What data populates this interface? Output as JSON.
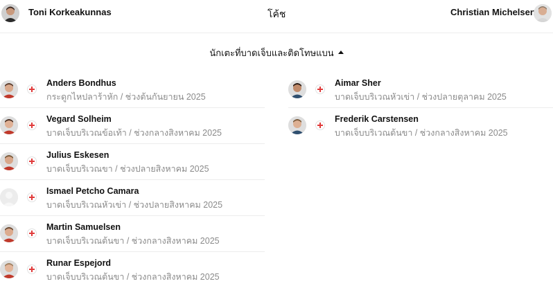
{
  "coaches": {
    "title": "โค้ช",
    "home_name": "Toni Korkeakunnas",
    "away_name": "Christian Michelsen"
  },
  "section": {
    "label": "นักเตะที่บาดเจ็บและติดโทษแบน",
    "icon": "caret-up-icon"
  },
  "left_players": [
    {
      "name": "Anders Bondhus",
      "detail": "กระดูกไหปลาร้าหัก / ช่วงต้นกันยายน 2025"
    },
    {
      "name": "Vegard Solheim",
      "detail": "บาดเจ็บบริเวณข้อเท้า / ช่วงกลางสิงหาคม 2025"
    },
    {
      "name": "Julius Eskesen",
      "detail": "บาดเจ็บบริเวณขา / ช่วงปลายสิงหาคม 2025"
    },
    {
      "name": "Ismael Petcho Camara",
      "detail": "บาดเจ็บบริเวณหัวเข่า / ช่วงปลายสิงหาคม 2025"
    },
    {
      "name": "Martin Samuelsen",
      "detail": "บาดเจ็บบริเวณต้นขา / ช่วงกลางสิงหาคม 2025"
    },
    {
      "name": "Runar Espejord",
      "detail": "บาดเจ็บบริเวณต้นขา / ช่วงกลางสิงหาคม 2025"
    }
  ],
  "right_players": [
    {
      "name": "Aimar Sher",
      "detail": "บาดเจ็บบริเวณหัวเข่า / ช่วงปลายตุลาคม 2025"
    },
    {
      "name": "Frederik Carstensen",
      "detail": "บาดเจ็บบริเวณต้นขา / ช่วงกลางสิงหาคม 2025"
    }
  ],
  "colors": {
    "injury_cross": "#e03a3a",
    "detail_text": "#8a8a8a",
    "divider": "#ececec"
  }
}
